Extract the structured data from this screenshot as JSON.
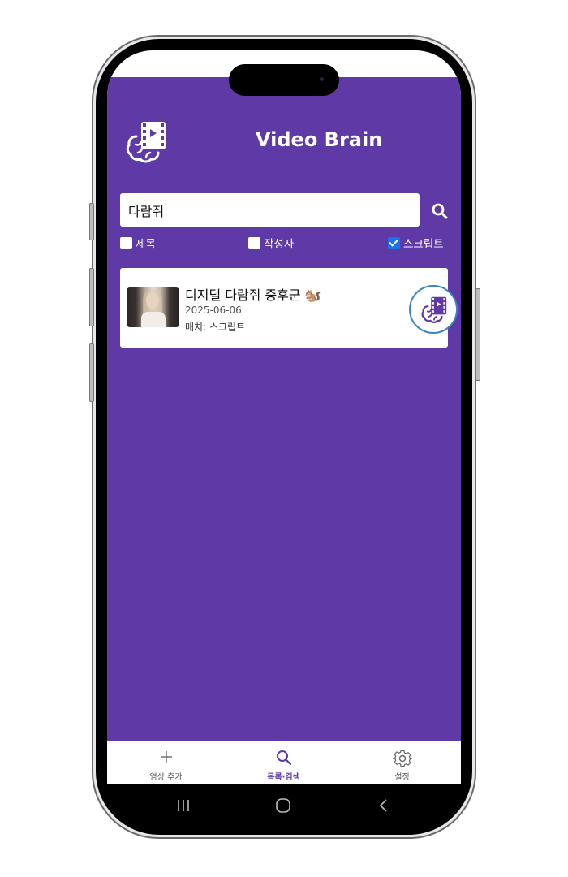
{
  "app": {
    "title": "Video Brain"
  },
  "search": {
    "value": "다람쥐"
  },
  "filters": [
    {
      "label": "제목",
      "checked": false
    },
    {
      "label": "작성자",
      "checked": false
    },
    {
      "label": "스크립트",
      "checked": true
    }
  ],
  "results": [
    {
      "title": "디지털 다람쥐 증후군 🐿️",
      "date": "2025-06-06",
      "match": "매치: 스크립트"
    }
  ],
  "bottom_nav": [
    {
      "label": "영상 추가",
      "icon": "plus-icon",
      "active": false
    },
    {
      "label": "목록·검색",
      "icon": "search-icon",
      "active": true
    },
    {
      "label": "설정",
      "icon": "gear-icon",
      "active": false
    }
  ],
  "colors": {
    "primary": "#5f3aa6",
    "fab_border": "#3a83c4",
    "checkbox": "#1a73e8"
  },
  "system_nav": {
    "icons": [
      "recent-apps-icon",
      "home-icon",
      "back-icon"
    ]
  }
}
